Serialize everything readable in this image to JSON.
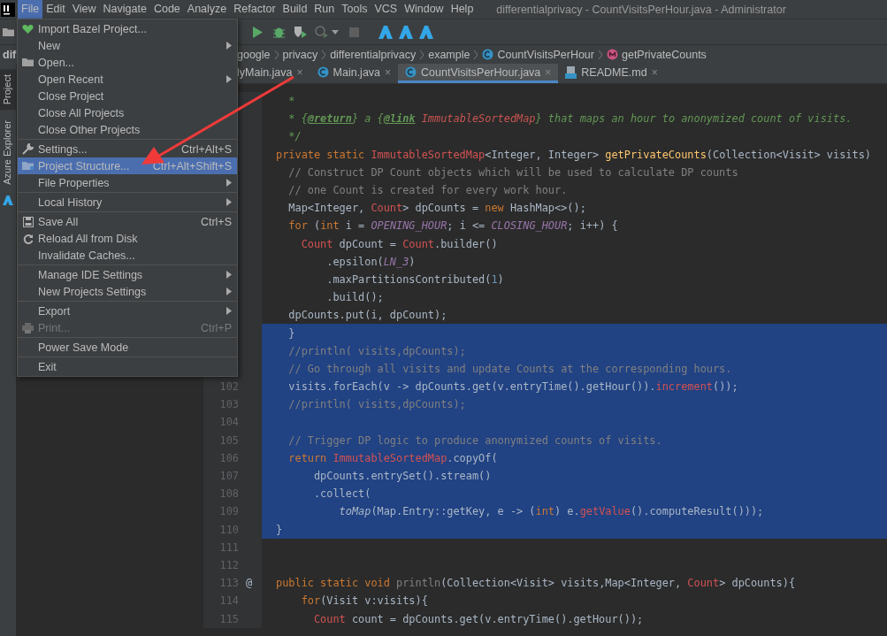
{
  "menubar": [
    {
      "label": "File",
      "selected": true
    },
    {
      "label": "Edit",
      "selected": false
    },
    {
      "label": "View",
      "selected": false
    },
    {
      "label": "Navigate",
      "selected": false
    },
    {
      "label": "Code",
      "selected": false
    },
    {
      "label": "Analyze",
      "selected": false
    },
    {
      "label": "Refactor",
      "selected": false
    },
    {
      "label": "Build",
      "selected": false
    },
    {
      "label": "Run",
      "selected": false
    },
    {
      "label": "Tools",
      "selected": false
    },
    {
      "label": "VCS",
      "selected": false
    },
    {
      "label": "Window",
      "selected": false
    },
    {
      "label": "Help",
      "selected": false
    }
  ],
  "window": {
    "title": "differentialprivacy - CountVisitsPerHour.java - Administrator"
  },
  "tool_strip": [
    {
      "label": "Project",
      "selected": true
    },
    {
      "label": "Azure Explorer",
      "selected": false
    }
  ],
  "project_panel": {
    "title": "dif"
  },
  "breadcrumbs": [
    {
      "label": "google",
      "kind": "package"
    },
    {
      "label": "privacy",
      "kind": "package"
    },
    {
      "label": "differentialprivacy",
      "kind": "package"
    },
    {
      "label": "example",
      "kind": "package"
    },
    {
      "label": "CountVisitsPerHour",
      "kind": "class"
    },
    {
      "label": "getPrivateCounts",
      "kind": "method"
    }
  ],
  "tabs": [
    {
      "label": "lyMain.java",
      "close": "×",
      "selected": false,
      "kind": "plain"
    },
    {
      "label": "Main.java",
      "close": "×",
      "selected": false,
      "kind": "class"
    },
    {
      "label": "CountVisitsPerHour.java",
      "close": "×",
      "selected": true,
      "kind": "class"
    },
    {
      "label": "README.md",
      "close": "×",
      "selected": false,
      "kind": "markdown"
    }
  ],
  "file_menu": [
    [
      {
        "label": "Import Bazel Project...",
        "submenu": false,
        "disabled": false,
        "selected": false
      },
      {
        "label": "New",
        "submenu": true,
        "disabled": false,
        "selected": false
      },
      {
        "label": "Open...",
        "submenu": false,
        "disabled": false,
        "selected": false
      },
      {
        "label": "Open Recent",
        "submenu": true,
        "disabled": false,
        "selected": false
      },
      {
        "label": "Close Project",
        "submenu": false,
        "disabled": false,
        "selected": false
      },
      {
        "label": "Close All Projects",
        "submenu": false,
        "disabled": false,
        "selected": false
      },
      {
        "label": "Close Other Projects",
        "submenu": false,
        "disabled": false,
        "selected": false
      }
    ],
    [
      {
        "label": "Settings...",
        "shortcut": "Ctrl+Alt+S",
        "submenu": false,
        "disabled": false,
        "selected": false
      },
      {
        "label": "Project Structure...",
        "shortcut": "Ctrl+Alt+Shift+S",
        "submenu": false,
        "disabled": false,
        "selected": true
      },
      {
        "label": "File Properties",
        "submenu": true,
        "disabled": false,
        "selected": false
      }
    ],
    [
      {
        "label": "Local History",
        "submenu": true,
        "disabled": false,
        "selected": false
      }
    ],
    [
      {
        "label": "Save All",
        "shortcut": "Ctrl+S",
        "submenu": false,
        "disabled": false,
        "selected": false
      },
      {
        "label": "Reload All from Disk",
        "submenu": false,
        "disabled": false,
        "selected": false
      },
      {
        "label": "Invalidate Caches...",
        "submenu": false,
        "disabled": false,
        "selected": false
      }
    ],
    [
      {
        "label": "Manage IDE Settings",
        "submenu": true,
        "disabled": false,
        "selected": false
      },
      {
        "label": "New Projects Settings",
        "submenu": true,
        "disabled": false,
        "selected": false
      }
    ],
    [
      {
        "label": "Export",
        "submenu": true,
        "disabled": false,
        "selected": false
      },
      {
        "label": "Print...",
        "shortcut": "Ctrl+P",
        "submenu": false,
        "disabled": true,
        "selected": false
      }
    ],
    [
      {
        "label": "Power Save Mode",
        "submenu": false,
        "disabled": false,
        "selected": false
      }
    ],
    [
      {
        "label": "Exit",
        "submenu": false,
        "disabled": false,
        "selected": false
      }
    ]
  ],
  "editor": {
    "lines": [
      {
        "selected": false,
        "tokens": [
          {
            "kind": "doc",
            "text": "  *"
          }
        ]
      },
      {
        "selected": false,
        "tokens": [
          {
            "kind": "doc",
            "text": "  * {"
          },
          {
            "kind": "doctag",
            "text": "@return"
          },
          {
            "kind": "doc",
            "text": "} a {"
          },
          {
            "kind": "doctag",
            "text": "@link"
          },
          {
            "kind": "docref",
            "text": " ImmutableSortedMap"
          },
          {
            "kind": "doc",
            "text": "} that maps an hour to anonymized count of visits."
          }
        ]
      },
      {
        "selected": false,
        "tokens": [
          {
            "kind": "doc",
            "text": "  */"
          }
        ]
      },
      {
        "selected": false,
        "tokens": [
          {
            "kind": "keyword",
            "text": "private static "
          },
          {
            "kind": "type",
            "text": "ImmutableSortedMap"
          },
          {
            "kind": "plain",
            "text": "<Integer, Integer> "
          },
          {
            "kind": "method",
            "text": "getPrivateCounts"
          },
          {
            "kind": "plain",
            "text": "(Collection<Visit> visits)"
          }
        ]
      },
      {
        "selected": false,
        "tokens": [
          {
            "kind": "comment",
            "text": "  // Construct DP Count objects which will be used to calculate DP counts"
          }
        ]
      },
      {
        "selected": false,
        "tokens": [
          {
            "kind": "comment",
            "text": "  // one Count is created for every work hour."
          }
        ]
      },
      {
        "selected": false,
        "tokens": [
          {
            "kind": "plain",
            "text": "  Map<Integer, "
          },
          {
            "kind": "type",
            "text": "Count"
          },
          {
            "kind": "plain",
            "text": "> dpCounts = "
          },
          {
            "kind": "keyword",
            "text": "new "
          },
          {
            "kind": "plain",
            "text": "HashMap<>();"
          }
        ]
      },
      {
        "selected": false,
        "tokens": [
          {
            "kind": "keyword",
            "text": "  for "
          },
          {
            "kind": "plain",
            "text": "("
          },
          {
            "kind": "keyword",
            "text": "int "
          },
          {
            "kind": "plain",
            "text": "i = "
          },
          {
            "kind": "constant",
            "text": "OPENING_HOUR"
          },
          {
            "kind": "plain",
            "text": "; i <= "
          },
          {
            "kind": "constant",
            "text": "CLOSING_HOUR"
          },
          {
            "kind": "plain",
            "text": "; i++) {"
          }
        ]
      },
      {
        "selected": false,
        "tokens": [
          {
            "kind": "type",
            "text": "    Count"
          },
          {
            "kind": "plain",
            "text": " dpCount = "
          },
          {
            "kind": "type",
            "text": "Count"
          },
          {
            "kind": "plain",
            "text": ".builder()"
          }
        ]
      },
      {
        "selected": false,
        "tokens": [
          {
            "kind": "plain",
            "text": "        .epsilon("
          },
          {
            "kind": "constant",
            "text": "LN_3"
          },
          {
            "kind": "plain",
            "text": ")"
          }
        ]
      },
      {
        "selected": false,
        "tokens": [
          {
            "kind": "plain",
            "text": "        .maxPartitionsContributed("
          },
          {
            "kind": "number",
            "text": "1"
          },
          {
            "kind": "plain",
            "text": ")"
          }
        ]
      },
      {
        "selected": false,
        "tokens": [
          {
            "kind": "plain",
            "text": "        .build();"
          }
        ]
      },
      {
        "selected": false,
        "tokens": [
          {
            "kind": "plain",
            "text": "  dpCounts.put(i, dpCount);"
          }
        ]
      },
      {
        "selected": true,
        "tokens": [
          {
            "kind": "plain",
            "text": "  }"
          }
        ]
      },
      {
        "selected": true,
        "tokens": [
          {
            "kind": "comment",
            "text": "  //println( visits,dpCounts);"
          }
        ]
      },
      {
        "selected": true,
        "tokens": [
          {
            "kind": "comment",
            "text": "  // Go through all visits and update Counts at the corresponding hours."
          }
        ]
      },
      {
        "number": "102",
        "selected": true,
        "tokens": [
          {
            "kind": "plain",
            "text": "  visits.forEach(v -> dpCounts.get(v.entryTime().getHour())."
          },
          {
            "kind": "error",
            "text": "increment"
          },
          {
            "kind": "plain",
            "text": "());"
          }
        ]
      },
      {
        "number": "103",
        "selected": true,
        "tokens": [
          {
            "kind": "comment",
            "text": "  //println( visits,dpCounts);"
          }
        ]
      },
      {
        "number": "104",
        "selected": true
      },
      {
        "number": "105",
        "selected": true,
        "tokens": [
          {
            "kind": "comment",
            "text": "  // Trigger DP logic to produce anonymized counts of visits."
          }
        ]
      },
      {
        "number": "106",
        "selected": true,
        "tokens": [
          {
            "kind": "keyword",
            "text": "  return "
          },
          {
            "kind": "type",
            "text": "ImmutableSortedMap"
          },
          {
            "kind": "plain",
            "text": ".copyOf("
          }
        ]
      },
      {
        "number": "107",
        "selected": true,
        "tokens": [
          {
            "kind": "plain",
            "text": "      dpCounts.entrySet().stream()"
          }
        ]
      },
      {
        "number": "108",
        "selected": true,
        "tokens": [
          {
            "kind": "plain",
            "text": "      .collect("
          }
        ]
      },
      {
        "number": "109",
        "selected": true,
        "tokens": [
          {
            "kind": "italic",
            "text": "          toMap"
          },
          {
            "kind": "plain",
            "text": "(Map.Entry::getKey, e -> ("
          },
          {
            "kind": "keyword",
            "text": "int"
          },
          {
            "kind": "plain",
            "text": ") e."
          },
          {
            "kind": "error",
            "text": "getValue"
          },
          {
            "kind": "plain",
            "text": "().computeResult()));"
          }
        ]
      },
      {
        "number": "110",
        "selected": true,
        "tokens": [
          {
            "kind": "plain",
            "text": "}"
          }
        ]
      },
      {
        "number": "111",
        "selected": false
      },
      {
        "number": "112",
        "selected": false
      },
      {
        "number": "113",
        "gutter_mark": "@",
        "selected": false,
        "tokens": [
          {
            "kind": "keyword",
            "text": "public static void "
          },
          {
            "kind": "unused",
            "text": "println"
          },
          {
            "kind": "plain",
            "text": "(Collection<Visit> visits,Map<Integer, "
          },
          {
            "kind": "type",
            "text": "Count"
          },
          {
            "kind": "plain",
            "text": "> dpCounts){"
          }
        ]
      },
      {
        "number": "114",
        "selected": false,
        "tokens": [
          {
            "kind": "keyword",
            "text": "    for"
          },
          {
            "kind": "plain",
            "text": "(Visit v:visits){"
          }
        ]
      },
      {
        "number": "115",
        "selected": false,
        "tokens": [
          {
            "kind": "type",
            "text": "      Count"
          },
          {
            "kind": "plain",
            "text": " count = dpCounts.get(v.entryTime().getHour());"
          }
        ]
      }
    ]
  }
}
